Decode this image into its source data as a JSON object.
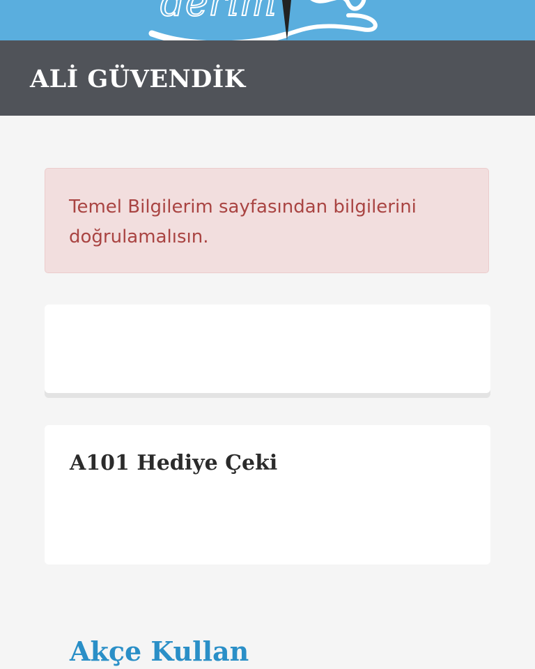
{
  "brand": {
    "logo_text": "derim"
  },
  "header": {
    "user_name": "ALİ GÜVENDİK"
  },
  "alert": {
    "message": "Temel Bilgilerim sayfasından bilgilerini doğrulamalısın."
  },
  "sections": {
    "akce_title": "Akçe Kullan",
    "gift_card_title": "A101 Hediye Çeki"
  },
  "colors": {
    "banner": "#5aaede",
    "header": "#505359",
    "alert_bg": "#f2dede",
    "alert_text": "#a94442",
    "accent": "#2a8fc7"
  }
}
